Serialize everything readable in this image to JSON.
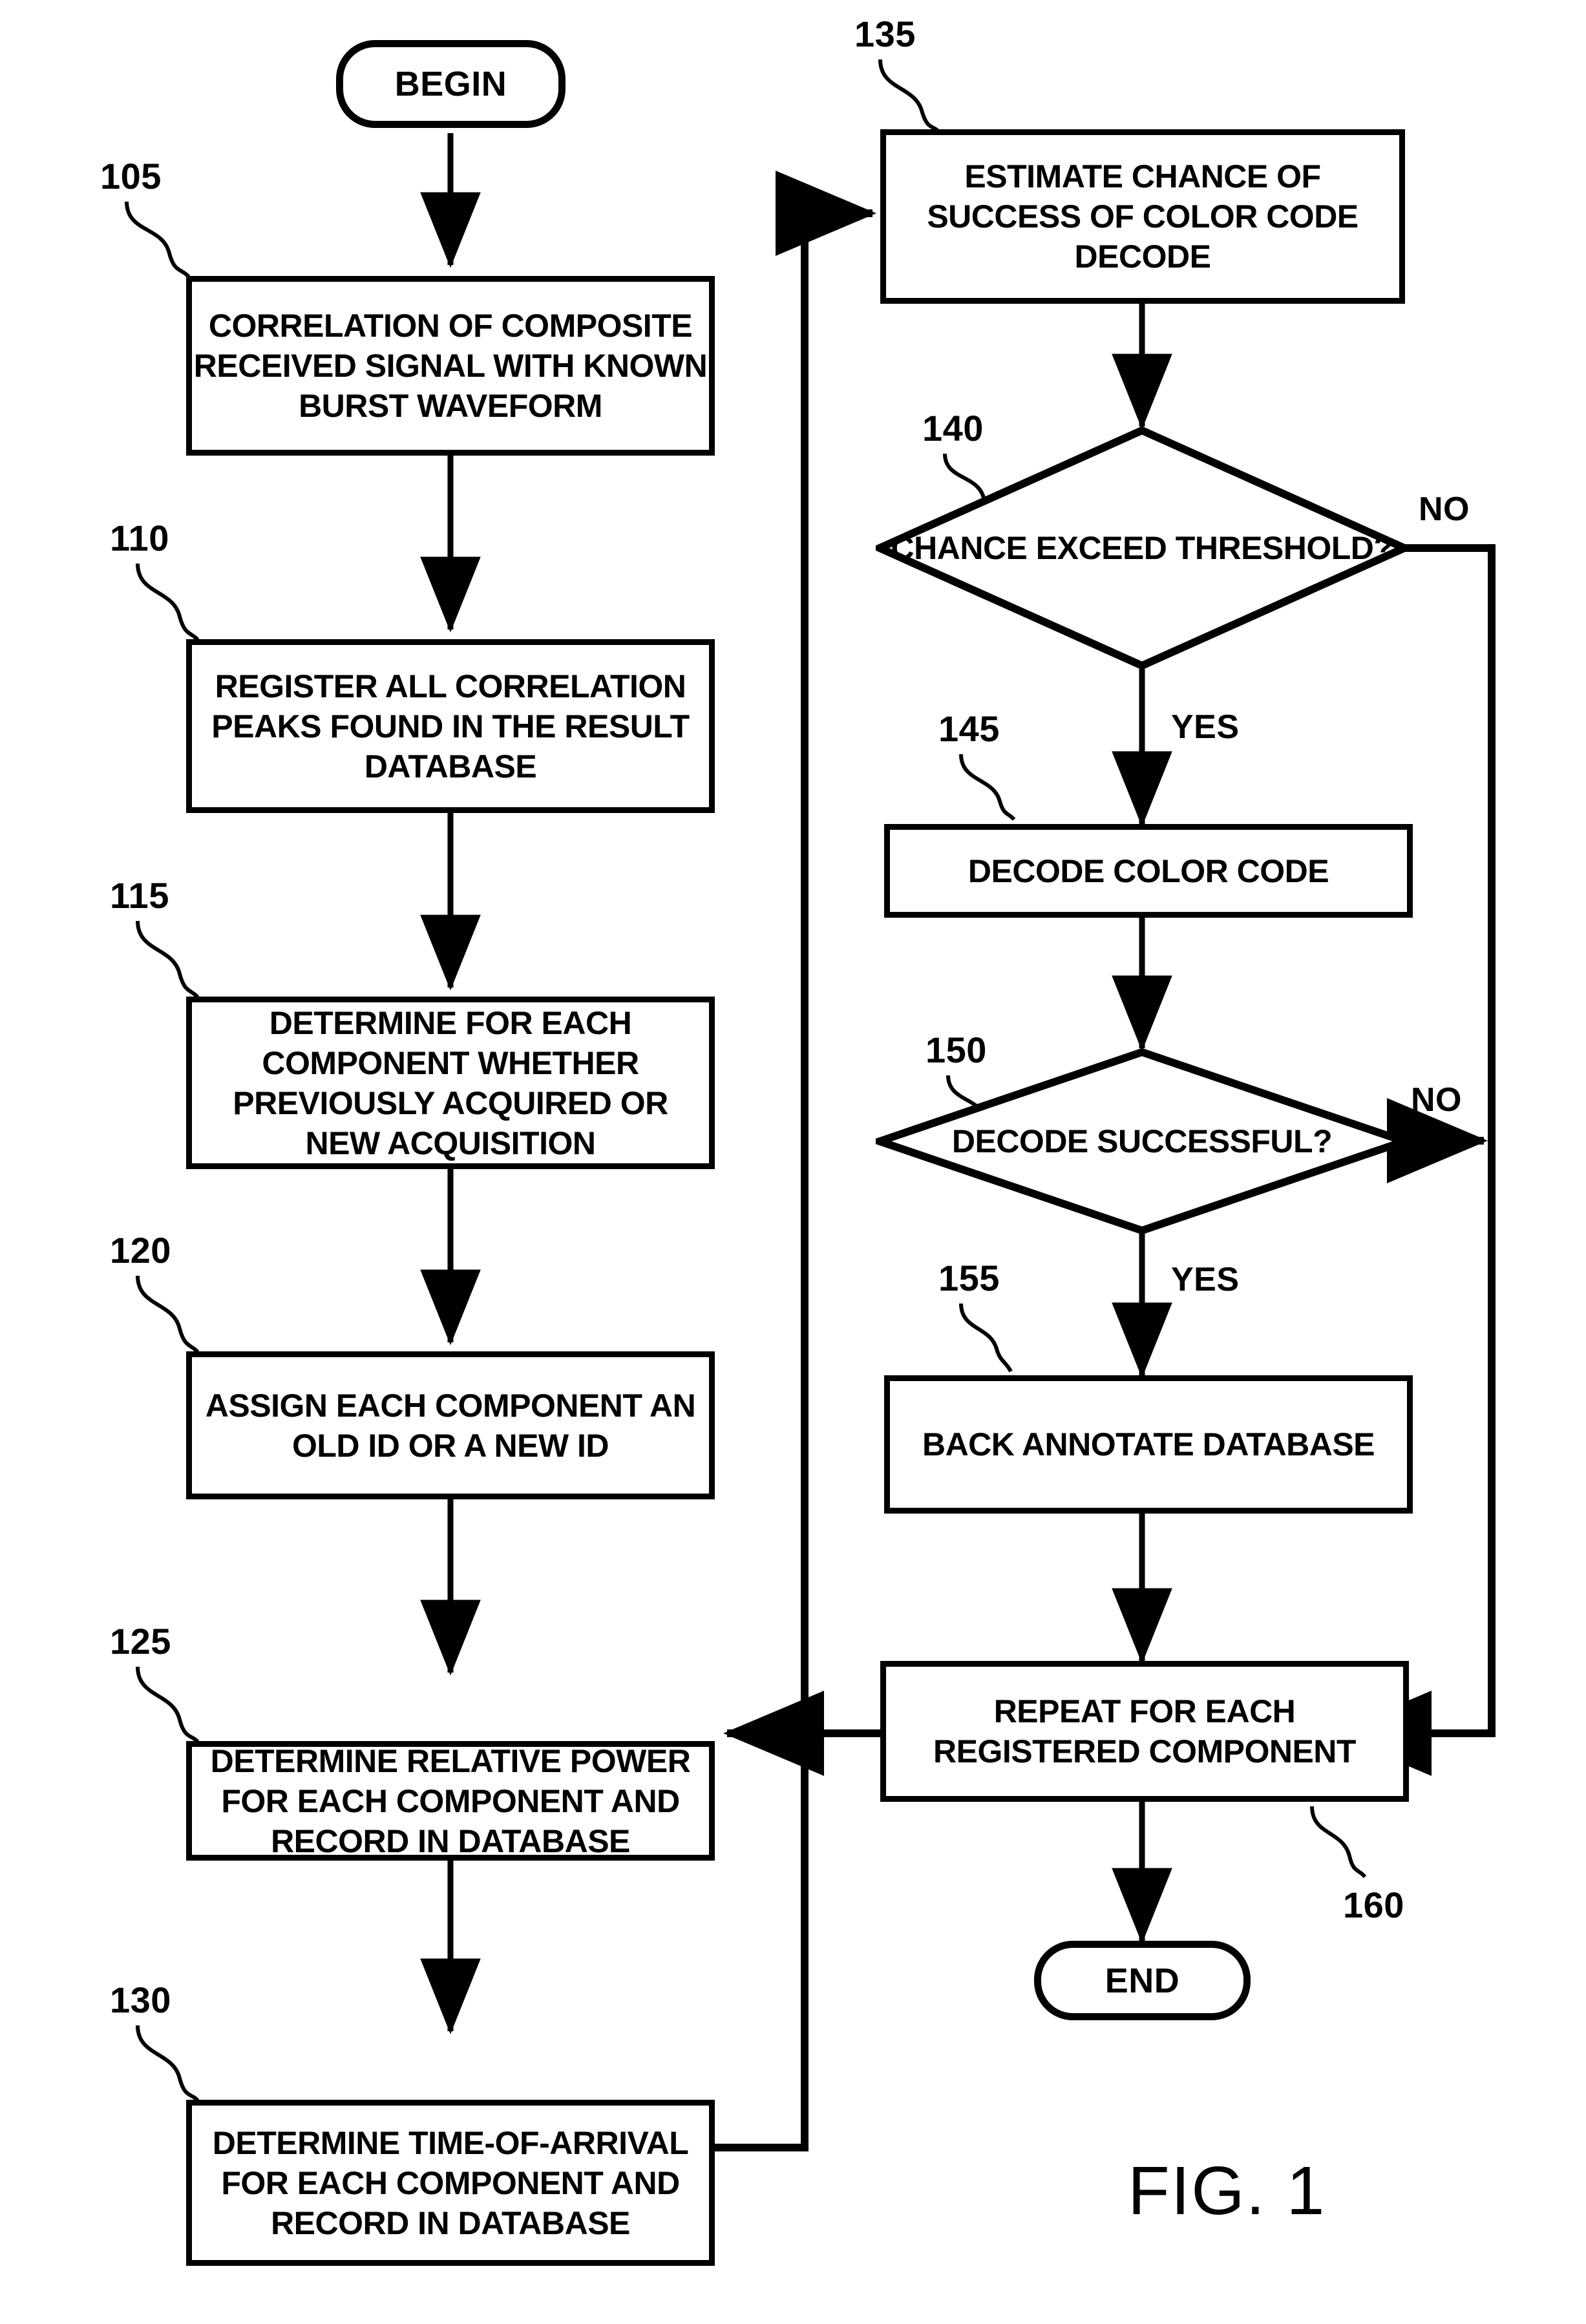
{
  "figure": {
    "caption": "FIG. 1",
    "type": "flowchart"
  },
  "nodes": {
    "begin": {
      "ref": "",
      "label": "BEGIN",
      "shape": "terminal"
    },
    "n105": {
      "ref": "105",
      "label": "CORRELATION OF COMPOSITE RECEIVED SIGNAL WITH KNOWN BURST WAVEFORM",
      "shape": "process"
    },
    "n110": {
      "ref": "110",
      "label": "REGISTER ALL CORRELATION PEAKS FOUND IN THE RESULT DATABASE",
      "shape": "process"
    },
    "n115": {
      "ref": "115",
      "label": "DETERMINE FOR EACH COMPONENT WHETHER PREVIOUSLY ACQUIRED OR NEW ACQUISITION",
      "shape": "process"
    },
    "n120": {
      "ref": "120",
      "label": "ASSIGN EACH COMPONENT AN OLD ID OR A NEW ID",
      "shape": "process"
    },
    "n125": {
      "ref": "125",
      "label": "DETERMINE RELATIVE POWER FOR EACH COMPONENT AND RECORD IN DATABASE",
      "shape": "process"
    },
    "n130": {
      "ref": "130",
      "label": "DETERMINE TIME-OF-ARRIVAL FOR EACH COMPONENT AND RECORD IN DATABASE",
      "shape": "process"
    },
    "n135": {
      "ref": "135",
      "label": "ESTIMATE CHANCE OF SUCCESS OF COLOR CODE DECODE",
      "shape": "process"
    },
    "n140": {
      "ref": "140",
      "label": "CHANCE EXCEED THRESHOLD?",
      "shape": "decision"
    },
    "n145": {
      "ref": "145",
      "label": "DECODE COLOR CODE",
      "shape": "process"
    },
    "n150": {
      "ref": "150",
      "label": "DECODE SUCCESSFUL?",
      "shape": "decision"
    },
    "n155": {
      "ref": "155",
      "label": "BACK ANNOTATE DATABASE",
      "shape": "process"
    },
    "n160": {
      "ref": "160",
      "label": "REPEAT FOR EACH REGISTERED COMPONENT",
      "shape": "process"
    },
    "end": {
      "ref": "",
      "label": "END",
      "shape": "terminal"
    }
  },
  "edge_labels": {
    "d140_no": "NO",
    "d140_yes": "YES",
    "d150_no": "NO",
    "d150_yes": "YES"
  },
  "colors": {
    "stroke": "#000000",
    "fill": "#ffffff"
  }
}
